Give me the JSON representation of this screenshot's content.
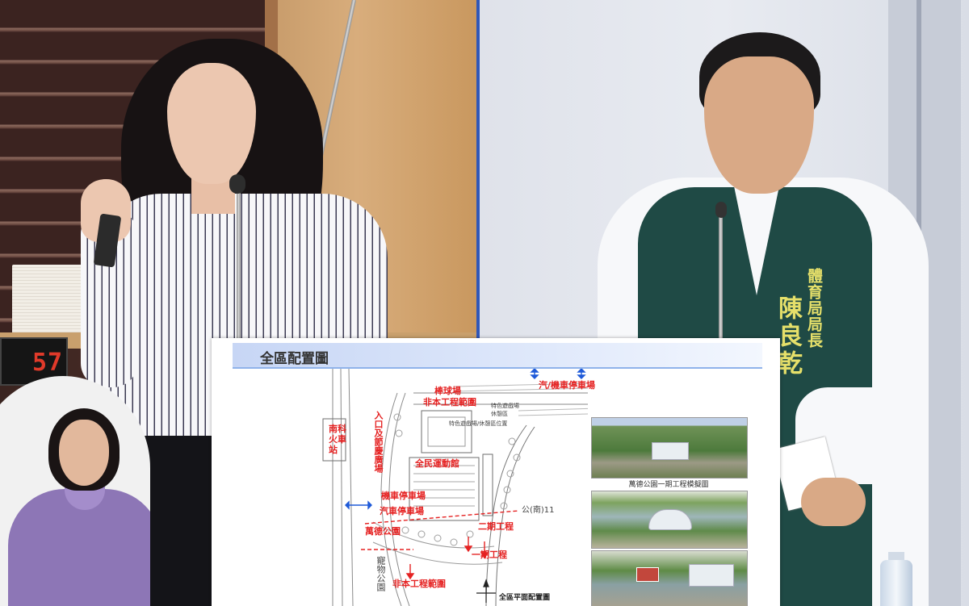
{
  "timer": {
    "value": "57"
  },
  "name_tag": {
    "title": "體育局局長",
    "name": "陳良乾"
  },
  "slide": {
    "title": "全區配置圖",
    "labels": {
      "south_station": "南科火車站",
      "entrance_plaza": "入口及節慶廣場",
      "baseball_field": "棒球場",
      "non_project_1": "非本工程範圍",
      "moto_parking_top": "汽/機車停車場",
      "sports_hall": "全民運動館",
      "moto_parking": "機車停車場",
      "car_parking": "汽車停車場",
      "wande_park": "萬德公園",
      "phase2": "二期工程",
      "phase1": "一期工程",
      "public_road": "公(南)11",
      "zoo_park": "寵物公園",
      "non_project_2": "非本工程範圍",
      "plan_caption": "全區平面配置圖",
      "small_note_1": "特色遊戲場/休憩區位置",
      "small_note_2": "特色遊戲場",
      "small_note_3": "休憩區"
    },
    "photo_caption": "萬德公園一期工程模擬圖"
  },
  "colors": {
    "label_red": "#e52222",
    "slide_header": "#c7d6f5",
    "vest_green": "#1f4a45",
    "tag_yellow": "#e6e06a"
  }
}
